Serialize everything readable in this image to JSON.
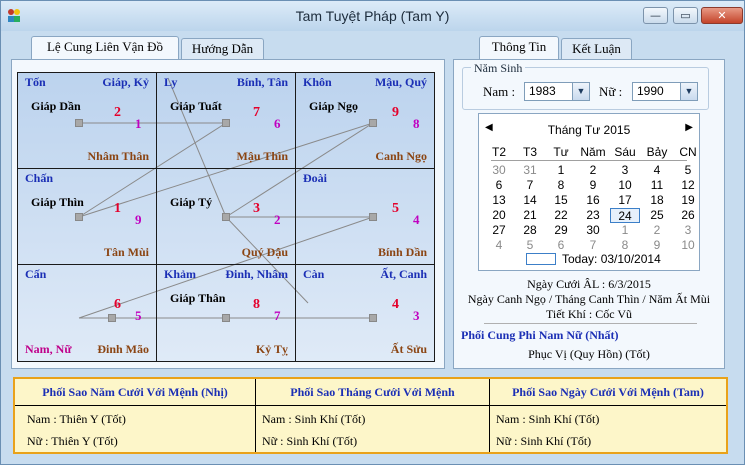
{
  "window": {
    "title": "Tam Tuyệt Pháp (Tam Y)",
    "minimize": "—",
    "maximize": "▭",
    "close": "✕"
  },
  "left_tabs": [
    "Lệ Cung Liên Vận Đồ",
    "Hướng Dẫn"
  ],
  "right_tabs": [
    "Thông Tin",
    "Kết Luận"
  ],
  "grid": [
    {
      "name": "Tốn",
      "can": "Giáp, Kỷ",
      "cung": "Giáp Dần",
      "n1": "2",
      "n2": "1",
      "bottom": "Nhâm Thân",
      "bottom_left": ""
    },
    {
      "name": "Ly",
      "can": "Bính, Tân",
      "cung": "Giáp Tuất",
      "n1": "7",
      "n2": "6",
      "bottom": "Mậu Thìn",
      "bottom_left": ""
    },
    {
      "name": "Khôn",
      "can": "Mậu, Quý",
      "cung": "Giáp Ngọ",
      "n1": "9",
      "n2": "8",
      "bottom": "Canh Ngọ",
      "bottom_left": ""
    },
    {
      "name": "Chấn",
      "can": "",
      "cung": "Giáp Thìn",
      "n1": "1",
      "n2": "9",
      "bottom": "Tân Mùi",
      "bottom_left": ""
    },
    {
      "name": "",
      "can": "",
      "cung": "Giáp Tý",
      "n1": "3",
      "n2": "2",
      "bottom": "Quý Dậu",
      "bottom_left": ""
    },
    {
      "name": "Đoài",
      "can": "",
      "cung": "",
      "n1": "5",
      "n2": "4",
      "bottom": "Bính Dần",
      "bottom_left": ""
    },
    {
      "name": "Cấn",
      "can": "",
      "cung": "",
      "n1": "6",
      "n2": "5",
      "bottom": "Đinh Mão",
      "bottom_left": "Nam, Nữ"
    },
    {
      "name": "Khảm",
      "can": "Đinh, Nhâm",
      "cung": "Giáp Thân",
      "n1": "8",
      "n2": "7",
      "bottom": "Kỷ Tỵ",
      "bottom_left": ""
    },
    {
      "name": "Càn",
      "can": "Ất, Canh",
      "cung": "",
      "n1": "4",
      "n2": "3",
      "bottom": "Ất Sửu",
      "bottom_left": ""
    }
  ],
  "birth": {
    "legend": "Năm Sinh",
    "nam_label": "Nam :",
    "nam_value": "1983",
    "nu_label": "Nữ :",
    "nu_value": "1990"
  },
  "calendar": {
    "header": "Tháng Tư 2015",
    "prev": "◀",
    "next": "▶",
    "weekdays": [
      "T2",
      "T3",
      "Tư",
      "Năm",
      "Sáu",
      "Bảy",
      "CN"
    ],
    "weeks": [
      [
        "30",
        "31",
        "1",
        "2",
        "3",
        "4",
        "5"
      ],
      [
        "6",
        "7",
        "8",
        "9",
        "10",
        "11",
        "12"
      ],
      [
        "13",
        "14",
        "15",
        "16",
        "17",
        "18",
        "19"
      ],
      [
        "20",
        "21",
        "22",
        "23",
        "24",
        "25",
        "26"
      ],
      [
        "27",
        "28",
        "29",
        "30",
        "1",
        "2",
        "3"
      ],
      [
        "4",
        "5",
        "6",
        "7",
        "8",
        "9",
        "10"
      ]
    ],
    "today_text": "Today: 03/10/2014"
  },
  "info": {
    "ngay_cuoi": "Ngày Cưới ÂL : 6/3/2015",
    "can_chi": "Ngày Canh Ngọ / Tháng Canh Thìn / Năm Ất Mùi",
    "tiet_khi": "Tiết Khí : Cốc Vũ",
    "phoi_cung_title": "Phối Cung Phi Nam Nữ (Nhất)",
    "phoi_cung_value": "Phục Vị (Quy Hồn) (Tốt)"
  },
  "bottom": [
    {
      "title": "Phối Sao Năm Cưới Với Mệnh (Nhị)",
      "nam": "Nam : Thiên Y (Tốt)",
      "nu": "Nữ : Thiên Y (Tốt)"
    },
    {
      "title": "Phối Sao Tháng Cưới Với Mệnh",
      "nam": "Nam : Sinh Khí (Tốt)",
      "nu": "Nữ : Sinh Khí (Tốt)"
    },
    {
      "title": "Phối Sao Ngày Cưới Với Mệnh (Tam)",
      "nam": "Nam : Sinh Khí (Tốt)",
      "nu": "Nữ : Sinh Khí (Tốt)"
    }
  ]
}
